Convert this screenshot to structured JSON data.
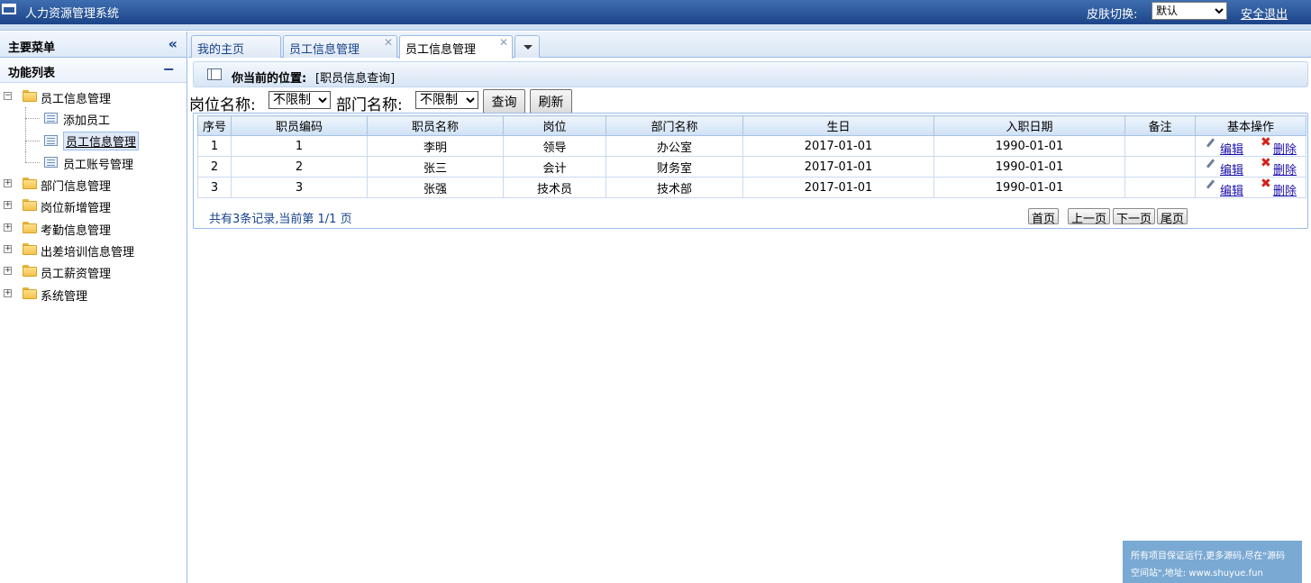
{
  "header": {
    "title": "人力资源管理系统",
    "skin_label": "皮肤切换:",
    "skin_selected": "默认",
    "logout": "安全退出"
  },
  "sidebar": {
    "panel_title": "主要菜单",
    "collapse_icon": "«",
    "section_title": "功能列表",
    "section_toggle": "−",
    "groups": [
      {
        "label": "员工信息管理",
        "expanded": true,
        "children": [
          "添加员工",
          "员工信息管理",
          "员工账号管理"
        ],
        "selected_child": "员工信息管理"
      },
      {
        "label": "部门信息管理"
      },
      {
        "label": "岗位新增管理"
      },
      {
        "label": "考勤信息管理"
      },
      {
        "label": "出差培训信息管理"
      },
      {
        "label": "员工薪资管理"
      },
      {
        "label": "系统管理"
      }
    ]
  },
  "tabs": [
    {
      "label": "我的主页",
      "closable": false
    },
    {
      "label": "员工信息管理",
      "closable": true
    },
    {
      "label": "员工信息管理",
      "closable": true,
      "active": true
    }
  ],
  "location": {
    "label": "你当前的位置:",
    "value": "[职员信息查询]"
  },
  "filter": {
    "position_label": "岗位名称:",
    "position_value": "不限制",
    "department_label": "部门名称:",
    "department_value": "不限制",
    "query_button": "查询",
    "refresh_button": "刷新"
  },
  "table": {
    "columns": [
      "序号",
      "职员编码",
      "职员名称",
      "岗位",
      "部门名称",
      "生日",
      "入职日期",
      "备注",
      "基本操作"
    ],
    "rows": [
      [
        "1",
        "1",
        "李明",
        "领导",
        "办公室",
        "2017-01-01",
        "1990-01-01",
        ""
      ],
      [
        "2",
        "2",
        "张三",
        "会计",
        "财务室",
        "2017-01-01",
        "1990-01-01",
        ""
      ],
      [
        "3",
        "3",
        "张强",
        "技术员",
        "技术部",
        "2017-01-01",
        "1990-01-01",
        ""
      ]
    ],
    "edit_label": "编辑",
    "delete_label": "删除"
  },
  "pager": {
    "info": "共有3条记录,当前第 1/1 页",
    "first": "首页",
    "prev": "上一页",
    "next": "下一页",
    "last": "尾页"
  },
  "watermark": {
    "line1": "所有项目保证运行,更多源码,尽在\"源码",
    "line2": "空间站\",地址: www.shuyue.fun"
  },
  "colors": {
    "header_bg": "#2c5a9e",
    "panel_border": "#99bbe8",
    "link": "#1a0dab",
    "delete_icon": "#d3221b"
  }
}
